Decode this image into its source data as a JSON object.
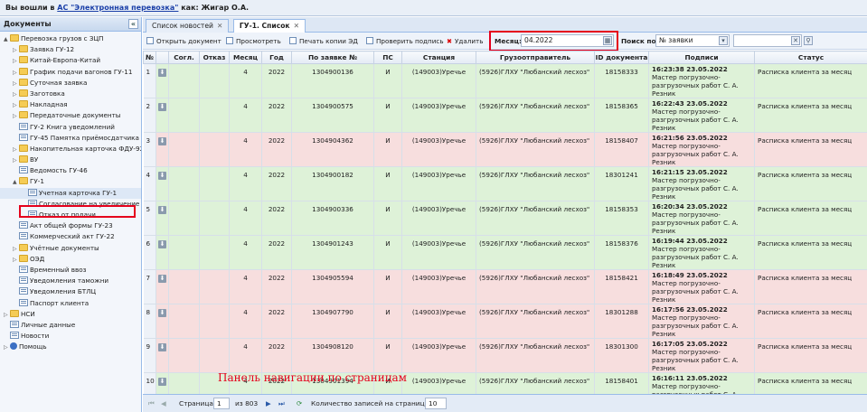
{
  "topbar": {
    "prefix": "Вы вошли в",
    "system": "АС \"Электронная перевозка\"",
    "as_label": "как:",
    "user": "Жигар О.А."
  },
  "sidebar": {
    "title": "Документы",
    "collapse": "«",
    "items": [
      {
        "label": "Перевозка грузов с ЗЦП",
        "icon": "folder",
        "indent": 0,
        "arrow": "▲"
      },
      {
        "label": "Заявка ГУ-12",
        "icon": "folder",
        "indent": 1,
        "arrow": "▷"
      },
      {
        "label": "Китай-Европа-Китай",
        "icon": "folder",
        "indent": 1,
        "arrow": "▷"
      },
      {
        "label": "График подачи вагонов ГУ-11",
        "icon": "folder",
        "indent": 1,
        "arrow": "▷"
      },
      {
        "label": "Суточная заявка",
        "icon": "folder",
        "indent": 1,
        "arrow": "▷"
      },
      {
        "label": "Заготовка",
        "icon": "folder",
        "indent": 1,
        "arrow": "▷"
      },
      {
        "label": "Накладная",
        "icon": "folder",
        "indent": 1,
        "arrow": "▷"
      },
      {
        "label": "Передаточные документы",
        "icon": "folder",
        "indent": 1,
        "arrow": "▷"
      },
      {
        "label": "ГУ-2 Книга уведомлений",
        "icon": "doc",
        "indent": 1,
        "arrow": ""
      },
      {
        "label": "ГУ-45 Памятка приёмосдатчика",
        "icon": "doc",
        "indent": 1,
        "arrow": ""
      },
      {
        "label": "Накопительная карточка ФДУ-92",
        "icon": "folder",
        "indent": 1,
        "arrow": "▷"
      },
      {
        "label": "ВУ",
        "icon": "folder",
        "indent": 1,
        "arrow": "▷"
      },
      {
        "label": "Ведомость ГУ-46",
        "icon": "doc",
        "indent": 1,
        "arrow": ""
      },
      {
        "label": "ГУ-1",
        "icon": "folder",
        "indent": 1,
        "arrow": "▲"
      },
      {
        "label": "Учетная карточка ГУ-1",
        "icon": "doc",
        "indent": 2,
        "arrow": "",
        "selected": true
      },
      {
        "label": "Согласование на увеличение по",
        "icon": "doc",
        "indent": 2,
        "arrow": ""
      },
      {
        "label": "Отказ от подачи",
        "icon": "doc",
        "indent": 2,
        "arrow": ""
      },
      {
        "label": "Акт общей формы ГУ-23",
        "icon": "doc",
        "indent": 1,
        "arrow": ""
      },
      {
        "label": "Коммерческий акт ГУ-22",
        "icon": "doc",
        "indent": 1,
        "arrow": ""
      },
      {
        "label": "Учётные документы",
        "icon": "folder",
        "indent": 1,
        "arrow": "▷"
      },
      {
        "label": "ОЭД",
        "icon": "folder",
        "indent": 1,
        "arrow": "▷"
      },
      {
        "label": "Временный ввоз",
        "icon": "doc",
        "indent": 1,
        "arrow": ""
      },
      {
        "label": "Уведомления таможни",
        "icon": "doc",
        "indent": 1,
        "arrow": ""
      },
      {
        "label": "Уведомления БТЛЦ",
        "icon": "doc",
        "indent": 1,
        "arrow": ""
      },
      {
        "label": "Паспорт клиента",
        "icon": "doc",
        "indent": 1,
        "arrow": ""
      },
      {
        "label": "НСИ",
        "icon": "folder",
        "indent": 0,
        "arrow": "▷"
      },
      {
        "label": "Личные данные",
        "icon": "doc",
        "indent": 0,
        "arrow": ""
      },
      {
        "label": "Новости",
        "icon": "doc",
        "indent": 0,
        "arrow": ""
      },
      {
        "label": "Помощь",
        "icon": "info",
        "indent": 0,
        "arrow": "▷"
      }
    ]
  },
  "tabs": [
    {
      "label": "Список новостей",
      "active": false
    },
    {
      "label": "ГУ-1. Список",
      "active": true
    }
  ],
  "toolbar": {
    "open": "Открыть документ",
    "view": "Просмотреть",
    "print": "Печать копии ЭД",
    "verify": "Проверить подпись",
    "delete": "Удалить",
    "month_label": "Месяц:",
    "month_value": "04.2022",
    "search_label": "Поиск по:",
    "search_by": "№ заявки",
    "search_value": ""
  },
  "columns": [
    "№",
    "",
    "Согл.",
    "Отказ",
    "Месяц",
    "Год",
    "По заявке №",
    "ПС",
    "Станция",
    "Грузоотправитель",
    "ID документа",
    "Подписи",
    "Статус"
  ],
  "rows": [
    {
      "n": "1",
      "month": "4",
      "year": "2022",
      "req": "1304900136",
      "ps": "И",
      "station": "(149003)Уречье",
      "sender": "(5926)ГЛХУ \"Любанский лесхоз\"",
      "id": "18158333",
      "time": "16:23:38 23.05.2022",
      "signer": "Мастер погрузочно-разгрузочных работ С. А. Резник",
      "status": "Расписка клиента за месяц",
      "color": "green"
    },
    {
      "n": "2",
      "month": "4",
      "year": "2022",
      "req": "1304900575",
      "ps": "И",
      "station": "(149003)Уречье",
      "sender": "(5926)ГЛХУ \"Любанский лесхоз\"",
      "id": "18158365",
      "time": "16:22:43 23.05.2022",
      "signer": "Мастер погрузочно-разгрузочных работ С. А. Резник",
      "status": "Расписка клиента за месяц",
      "color": "green"
    },
    {
      "n": "3",
      "month": "4",
      "year": "2022",
      "req": "1304904362",
      "ps": "И",
      "station": "(149003)Уречье",
      "sender": "(5926)ГЛХУ \"Любанский лесхоз\"",
      "id": "18158407",
      "time": "16:21:56 23.05.2022",
      "signer": "Мастер погрузочно-разгрузочных работ С. А. Резник",
      "status": "Расписка клиента за месяц",
      "color": "pink"
    },
    {
      "n": "4",
      "month": "4",
      "year": "2022",
      "req": "1304900182",
      "ps": "И",
      "station": "(149003)Уречье",
      "sender": "(5926)ГЛХУ \"Любанский лесхоз\"",
      "id": "18301241",
      "time": "16:21:15 23.05.2022",
      "signer": "Мастер погрузочно-разгрузочных работ С. А. Резник",
      "status": "Расписка клиента за месяц",
      "color": "green"
    },
    {
      "n": "5",
      "month": "4",
      "year": "2022",
      "req": "1304900336",
      "ps": "И",
      "station": "(149003)Уречье",
      "sender": "(5926)ГЛХУ \"Любанский лесхоз\"",
      "id": "18158353",
      "time": "16:20:34 23.05.2022",
      "signer": "Мастер погрузочно-разгрузочных работ С. А. Резник",
      "status": "Расписка клиента за месяц",
      "color": "green"
    },
    {
      "n": "6",
      "month": "4",
      "year": "2022",
      "req": "1304901243",
      "ps": "И",
      "station": "(149003)Уречье",
      "sender": "(5926)ГЛХУ \"Любанский лесхоз\"",
      "id": "18158376",
      "time": "16:19:44 23.05.2022",
      "signer": "Мастер погрузочно-разгрузочных работ С. А. Резник",
      "status": "Расписка клиента за месяц",
      "color": "green"
    },
    {
      "n": "7",
      "month": "4",
      "year": "2022",
      "req": "1304905594",
      "ps": "И",
      "station": "(149003)Уречье",
      "sender": "(5926)ГЛХУ \"Любанский лесхоз\"",
      "id": "18158421",
      "time": "16:18:49 23.05.2022",
      "signer": "Мастер погрузочно-разгрузочных работ С. А. Резник",
      "status": "Расписка клиента за месяц",
      "color": "pink"
    },
    {
      "n": "8",
      "month": "4",
      "year": "2022",
      "req": "1304907790",
      "ps": "И",
      "station": "(149003)Уречье",
      "sender": "(5926)ГЛХУ \"Любанский лесхоз\"",
      "id": "18301288",
      "time": "16:17:56 23.05.2022",
      "signer": "Мастер погрузочно-разгрузочных работ С. А. Резник",
      "status": "Расписка клиента за месяц",
      "color": "pink"
    },
    {
      "n": "9",
      "month": "4",
      "year": "2022",
      "req": "1304908120",
      "ps": "И",
      "station": "(149003)Уречье",
      "sender": "(5926)ГЛХУ \"Любанский лесхоз\"",
      "id": "18301300",
      "time": "16:17:05 23.05.2022",
      "signer": "Мастер погрузочно-разгрузочных работ С. А. Резник",
      "status": "Расписка клиента за месяц",
      "color": "pink"
    },
    {
      "n": "10",
      "month": "4",
      "year": "2022",
      "req": "1304901394",
      "ps": "И",
      "station": "(149003)Уречье",
      "sender": "(5926)ГЛХУ \"Любанский лесхоз\"",
      "id": "18158401",
      "time": "16:16:11 23.05.2022",
      "signer": "Мастер погрузочно-разгрузочных работ С. А. Резник",
      "status": "Расписка клиента за месяц",
      "color": "green"
    }
  ],
  "annotation": "Панель навигации по страницам",
  "pager": {
    "page_label": "Страница",
    "page": "1",
    "of_label": "из 803",
    "per_page_label": "Количество записей на странице:",
    "per_page": "10"
  },
  "colors": {
    "highlight": "#e5001c",
    "green_row": "#def2d8",
    "pink_row": "#f7dede"
  }
}
